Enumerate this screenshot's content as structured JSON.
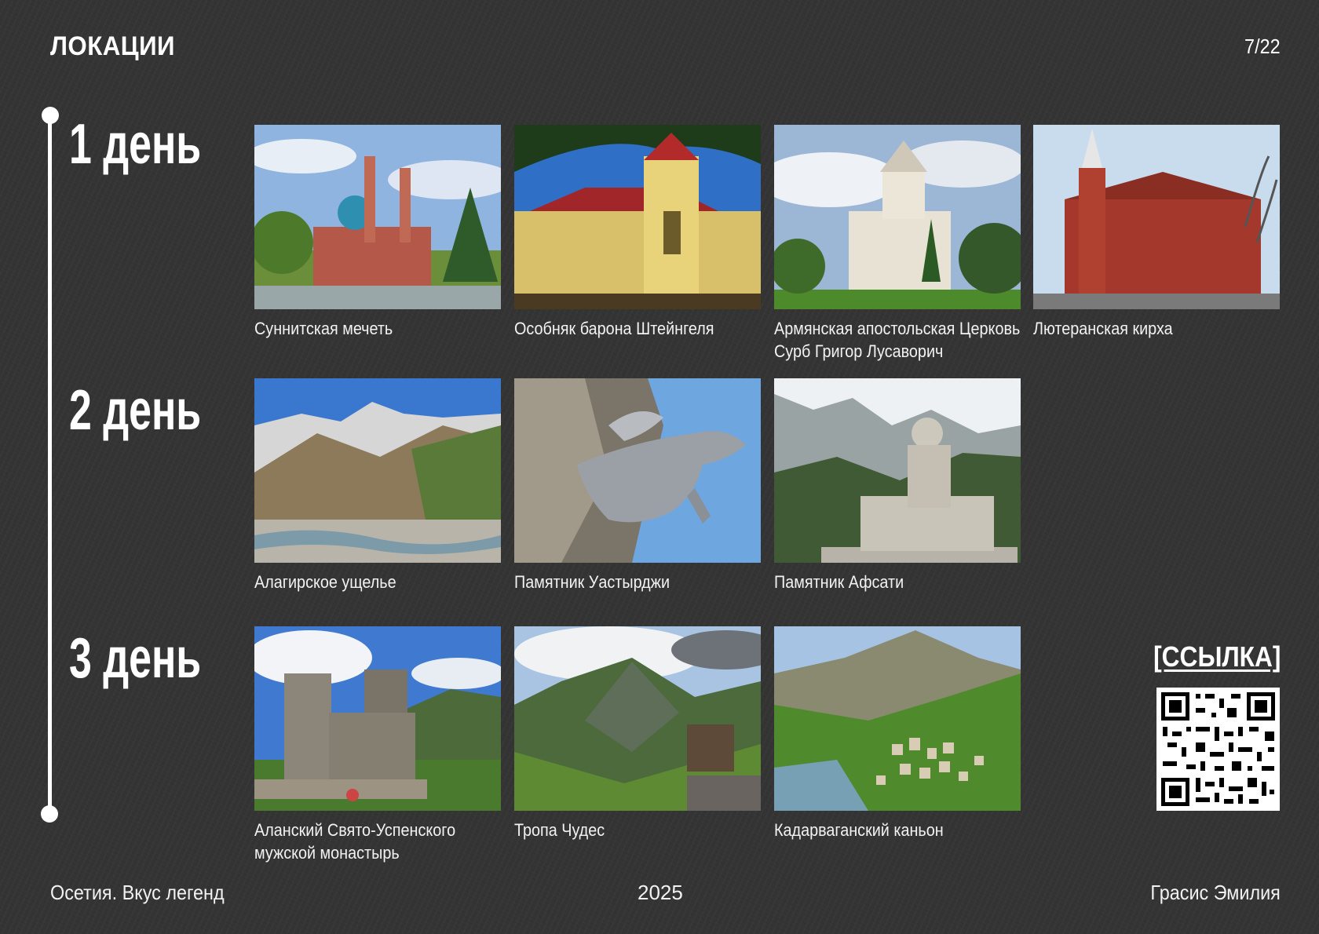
{
  "header": {
    "title": "ЛОКАЦИИ",
    "page": "7/22"
  },
  "days": [
    {
      "label": "1 день",
      "locations": [
        "Суннитская мечеть",
        "Особняк барона Штейнгеля",
        "Армянская апостольская Церковь Сурб Григор Лусаворич",
        "Лютеранская кирха"
      ]
    },
    {
      "label": "2 день",
      "locations": [
        "Алагирское ущелье",
        "Памятник Уастырджи",
        "Памятник Афсати"
      ]
    },
    {
      "label": "3 день",
      "locations": [
        "Аланский Свято-Успенского мужской монастырь",
        "Тропа Чудес",
        "Кадарваганский каньон"
      ]
    }
  ],
  "link": {
    "label": "[ССЫЛКА]"
  },
  "footer": {
    "left": "Осетия. Вкус легенд",
    "center": "2025",
    "right": "Грасис Эмилия"
  },
  "colors": {
    "background": "#343434",
    "text": "#ffffff"
  }
}
